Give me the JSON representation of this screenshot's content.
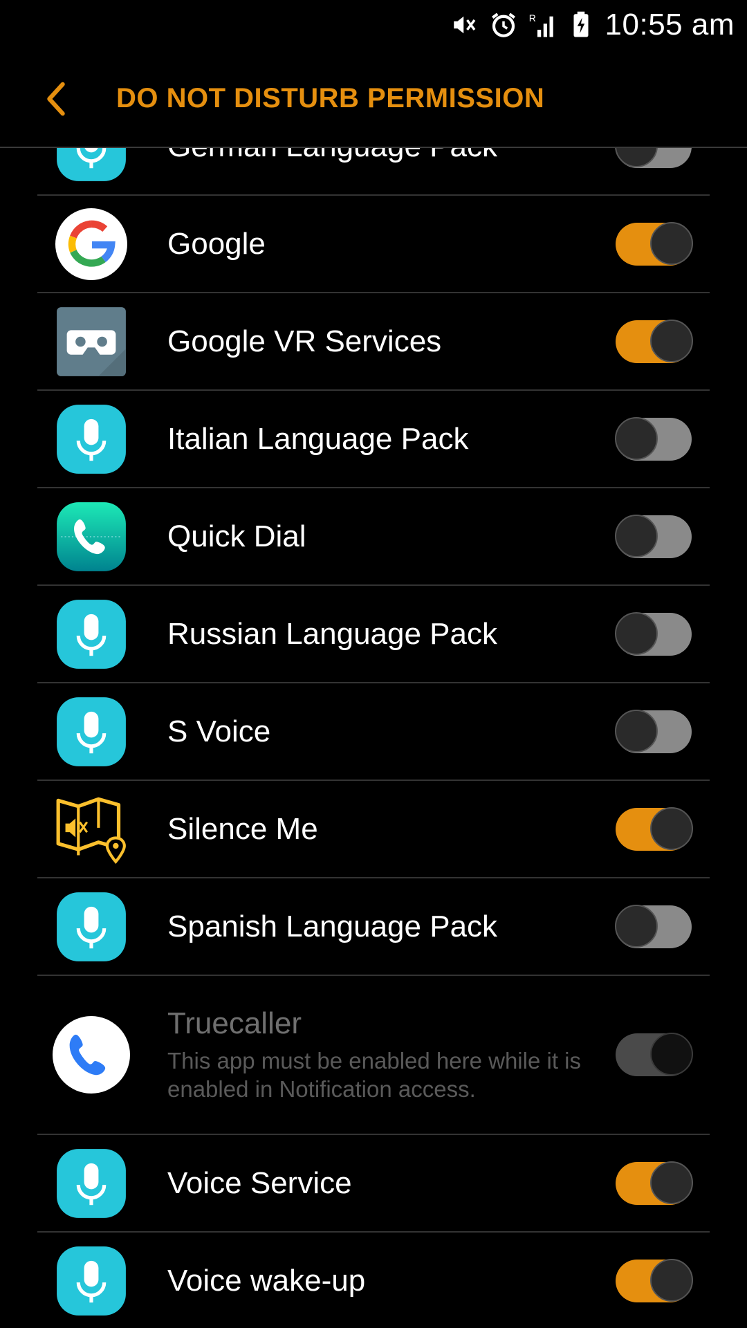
{
  "status_bar": {
    "time": "10:55 am"
  },
  "header": {
    "title": "DO NOT DISTURB PERMISSION"
  },
  "apps": [
    {
      "label": "German Language Pack",
      "icon": "voice-mic-icon",
      "enabled": false
    },
    {
      "label": "Google",
      "icon": "google-icon",
      "enabled": true
    },
    {
      "label": "Google VR Services",
      "icon": "vr-headset-icon",
      "enabled": true
    },
    {
      "label": "Italian Language Pack",
      "icon": "voice-mic-icon",
      "enabled": false
    },
    {
      "label": "Quick Dial",
      "icon": "phone-icon",
      "enabled": false
    },
    {
      "label": "Russian Language Pack",
      "icon": "voice-mic-icon",
      "enabled": false
    },
    {
      "label": "S Voice",
      "icon": "voice-mic-icon",
      "enabled": false
    },
    {
      "label": "Silence Me",
      "icon": "map-mute-icon",
      "enabled": true
    },
    {
      "label": "Spanish Language Pack",
      "icon": "voice-mic-icon",
      "enabled": false
    },
    {
      "label": "Truecaller",
      "icon": "truecaller-phone-icon",
      "enabled": true,
      "disabled_control": true,
      "description": "This app must be enabled here while it is enabled in Notification access."
    },
    {
      "label": "Voice Service",
      "icon": "voice-mic-icon",
      "enabled": true
    },
    {
      "label": "Voice wake-up",
      "icon": "voice-mic-icon",
      "enabled": true
    }
  ],
  "colors": {
    "accent": "#e58f0f",
    "background": "#000000",
    "divider": "#333333"
  }
}
